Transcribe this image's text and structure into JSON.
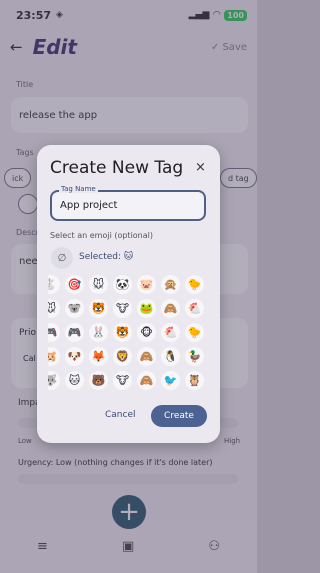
{
  "status": {
    "time": "23:57",
    "battery": "100"
  },
  "topbar": {
    "title": "Edit",
    "save_label": "Save"
  },
  "form": {
    "title_label": "Title",
    "title_value": "release the app",
    "tags_label": "Tags",
    "tag_chips": [
      "ick",
      "d tag"
    ],
    "desc_label": "Descr",
    "desc_value": "nee",
    "priority_label": "Prio",
    "priority_partial": "Cal",
    "impact_label": "Impa",
    "urgency_label": "Urgency: Low (nothing changes if it's done later)",
    "low": "Low",
    "high": "High"
  },
  "dialog": {
    "title": "Create New Tag",
    "close_icon": "×",
    "input_label": "Tag Name",
    "input_value": "App project",
    "emoji_label": "Select an emoji (optional)",
    "clear_icon": "∅",
    "selected_label": "Selected:",
    "selected_emoji": "🐱",
    "cancel_label": "Cancel",
    "create_label": "Create",
    "emoji_rows": [
      [
        "🐇",
        "🎯",
        "🐭",
        "🐼",
        "🐷",
        "🙊",
        "🐤"
      ],
      [
        "🐭",
        "🐨",
        "🐯",
        "🐮",
        "🐸",
        "🙈",
        "🐔"
      ],
      [
        "🎮",
        "🎮",
        "🐰",
        "🐯",
        "🐵",
        "🐔",
        "🐤"
      ],
      [
        "🐹",
        "🐶",
        "🦊",
        "🦁",
        "🙈",
        "🐧",
        "🦆"
      ],
      [
        "🐺",
        "🐱",
        "🐻",
        "🐮",
        "🙈",
        "🐦",
        "🦉"
      ]
    ]
  },
  "nav": {
    "plus": "+",
    "icon1": "≡",
    "icon2": "▣",
    "icon3": "⚇"
  }
}
